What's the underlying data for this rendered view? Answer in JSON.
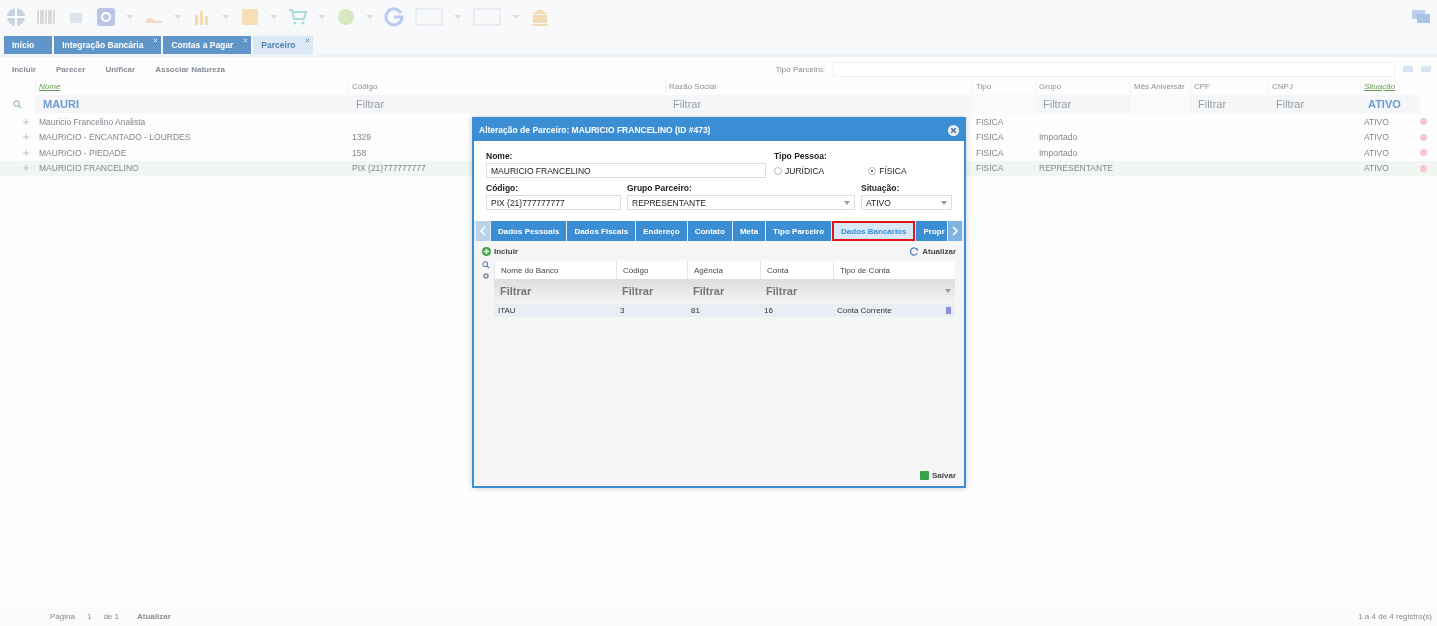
{
  "app_tabs": [
    {
      "label": "Início",
      "selected": false,
      "closable": false
    },
    {
      "label": "Integração Bancária",
      "selected": false,
      "closable": true
    },
    {
      "label": "Contas a Pagar",
      "selected": false,
      "closable": true
    },
    {
      "label": "Parceiro",
      "selected": true,
      "closable": true
    }
  ],
  "actions": [
    "Incluir",
    "Parecer",
    "Unificar",
    "Associar Natureza"
  ],
  "tipo_parceiro": {
    "label": "Tipo Parceiro:"
  },
  "grid": {
    "columns": [
      {
        "label": "Nome",
        "sorted": true,
        "filter": {
          "value": "MAURI"
        }
      },
      {
        "label": "Código",
        "sorted": false,
        "filter": {
          "placeholder": "Filtrar"
        }
      },
      {
        "label": "Razão Social",
        "sorted": false,
        "filter": {
          "placeholder": "Filtrar"
        }
      },
      {
        "label": "Tipo",
        "sorted": false
      },
      {
        "label": "Grupo",
        "sorted": false,
        "filter": {
          "placeholder": "Filtrar"
        }
      },
      {
        "label": "Mês Aniversár",
        "sorted": false
      },
      {
        "label": "CPF",
        "sorted": false,
        "filter": {
          "placeholder": "Filtrar"
        }
      },
      {
        "label": "CNPJ",
        "sorted": false,
        "filter": {
          "placeholder": "Filtrar"
        }
      },
      {
        "label": "Situação",
        "sorted": true,
        "filter": {
          "value": "ATIVO"
        }
      }
    ],
    "rows": [
      {
        "selected": false,
        "cells": [
          "Mauricio Francelino Analista",
          "",
          "",
          "FISICA",
          "",
          "",
          "",
          "",
          "ATIVO"
        ]
      },
      {
        "selected": false,
        "cells": [
          "MAURICIO - ENCANTADO - LOURDES",
          "1329",
          "",
          "FISICA",
          "Importado",
          "",
          "",
          "",
          "ATIVO"
        ]
      },
      {
        "selected": false,
        "cells": [
          "MAURICIO - PIEDADE",
          "158",
          "",
          "FISICA",
          "Importado",
          "",
          "",
          "",
          "ATIVO"
        ]
      },
      {
        "selected": true,
        "cells": [
          "MAURICIO FRANCELINO",
          "PIX (21)777777777",
          "",
          "FISICA",
          "REPRESENTANTE",
          "",
          "",
          "",
          "ATIVO"
        ]
      }
    ]
  },
  "pager": {
    "page_label": "Página",
    "page": "1",
    "of": "de 1",
    "refresh": "Atualizar",
    "summary": "1 a 4 de 4 registro(s)"
  },
  "dialog": {
    "title": "Alteração de Parceiro: MAURICIO FRANCELINO (ID #473)",
    "nome": {
      "label": "Nome:",
      "value": "MAURICIO FRANCELINO"
    },
    "tipo_pessoa": {
      "label": "Tipo Pessoa:",
      "options": [
        {
          "label": "JURÍDICA",
          "selected": false
        },
        {
          "label": "FÍSICA",
          "selected": true
        }
      ]
    },
    "codigo": {
      "label": "Código:",
      "value": "PIX (21)777777777"
    },
    "grupo": {
      "label": "Grupo Parceiro:",
      "value": "REPRESENTANTE"
    },
    "situacao": {
      "label": "Situação:",
      "value": "ATIVO"
    },
    "tabs": [
      {
        "label": "Dados Pessoais",
        "selected": false,
        "highlighted": false
      },
      {
        "label": "Dados Fiscais",
        "selected": false,
        "highlighted": false
      },
      {
        "label": "Endereço",
        "selected": false,
        "highlighted": false
      },
      {
        "label": "Contato",
        "selected": false,
        "highlighted": false
      },
      {
        "label": "Meta",
        "selected": false,
        "highlighted": false
      },
      {
        "label": "Tipo Parceiro",
        "selected": false,
        "highlighted": false
      },
      {
        "label": "Dados Bancários",
        "selected": true,
        "highlighted": true
      },
      {
        "label": "Propr",
        "selected": false,
        "highlighted": false
      }
    ],
    "add": "Incluir",
    "refresh": "Atualizar",
    "bank_grid": {
      "columns": [
        {
          "label": "Nome do Banco",
          "placeholder": "Filtrar"
        },
        {
          "label": "Código",
          "placeholder": "Filtrar"
        },
        {
          "label": "Agência",
          "placeholder": "Filtrar"
        },
        {
          "label": "Conta",
          "placeholder": "Filtrar"
        },
        {
          "label": "Tipo de Conta"
        }
      ],
      "rows": [
        {
          "cells": [
            "ITAU",
            "3",
            "81",
            "16",
            "Conta Corrente"
          ]
        }
      ]
    },
    "save": "Salvar"
  }
}
